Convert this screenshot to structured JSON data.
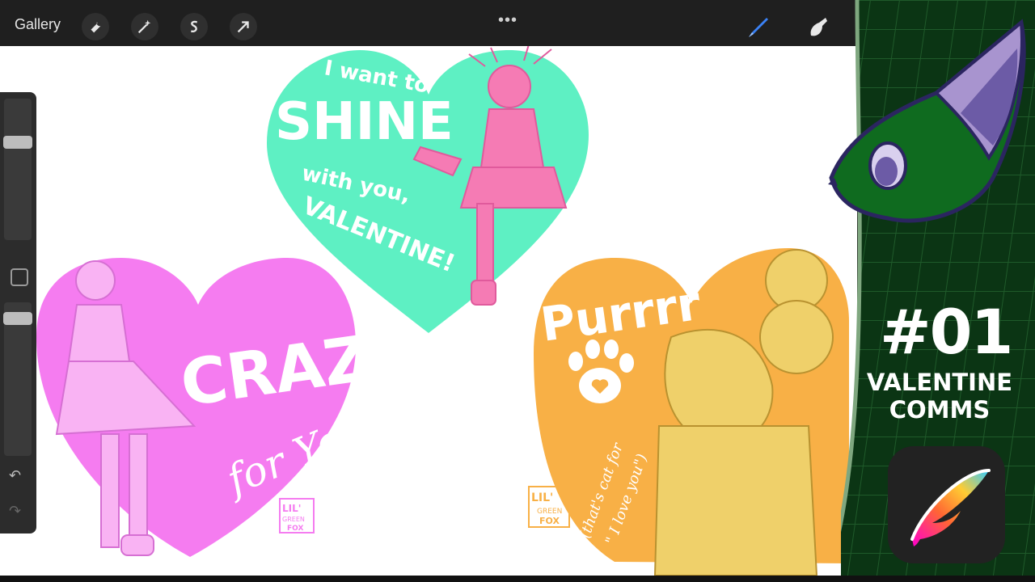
{
  "toolbar": {
    "gallery_label": "Gallery",
    "more_label": "•••",
    "tools": [
      "wrench-icon",
      "magic-wand-icon",
      "selection-icon",
      "transform-arrow-icon"
    ],
    "brush_icon": "brush-icon",
    "smudge_icon": "smudge-icon"
  },
  "sidebar": {
    "undo_glyph": "↶",
    "redo_glyph": "↷"
  },
  "artwork": {
    "teal_heart": {
      "line1": "I want to",
      "line2": "SHINE",
      "line3": "with you,",
      "line4": "VALENTINE!"
    },
    "pink_heart": {
      "line1": "CRAZY",
      "line2": "for You"
    },
    "orange_heart": {
      "line1": "Purrrr",
      "note1": "(that's cat for",
      "note2": "\" I love you\")"
    },
    "signature": {
      "line1": "LIL'",
      "line2": "GREEN",
      "line3": "FOX"
    },
    "colors": {
      "teal": "#5ef0c3",
      "pink": "#f57cf0",
      "orange": "#f8b046",
      "girl": "#f57bb4",
      "cat": "#efd06a"
    }
  },
  "panel": {
    "episode": "#01",
    "title_line1": "VALENTINE",
    "title_line2": "COMMS",
    "app_icon": "procreate-icon",
    "bg_color": "#0b3514",
    "grid_color": "#1f5a2a"
  }
}
